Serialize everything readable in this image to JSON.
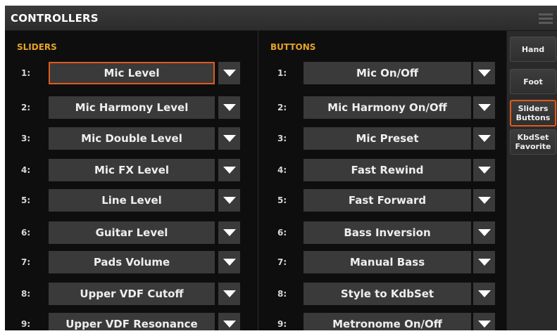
{
  "header": {
    "title": "CONTROLLERS",
    "menu_icon": "hamburger-menu-icon"
  },
  "sliders": {
    "label": "SLIDERS",
    "rows": [
      {
        "num": "1:",
        "value": "Mic Level"
      },
      {
        "num": "2:",
        "value": "Mic Harmony Level"
      },
      {
        "num": "3:",
        "value": "Mic Double Level"
      },
      {
        "num": "4:",
        "value": "Mic FX Level"
      },
      {
        "num": "5:",
        "value": "Line Level"
      },
      {
        "num": "6:",
        "value": "Guitar Level"
      },
      {
        "num": "7:",
        "value": "Pads Volume"
      },
      {
        "num": "8:",
        "value": "Upper VDF Cutoff"
      },
      {
        "num": "9:",
        "value": "Upper VDF Resonance"
      }
    ]
  },
  "buttons": {
    "label": "BUTTONS",
    "rows": [
      {
        "num": "1:",
        "value": "Mic On/Off"
      },
      {
        "num": "2:",
        "value": "Mic Harmony On/Off"
      },
      {
        "num": "3:",
        "value": "Mic Preset"
      },
      {
        "num": "4:",
        "value": "Fast Rewind"
      },
      {
        "num": "5:",
        "value": "Fast Forward"
      },
      {
        "num": "6:",
        "value": "Bass Inversion"
      },
      {
        "num": "7:",
        "value": "Manual Bass"
      },
      {
        "num": "8:",
        "value": "Style to KdbSet"
      },
      {
        "num": "9:",
        "value": "Metronome On/Off"
      }
    ]
  },
  "tabs": [
    {
      "line1": "Hand",
      "line2": ""
    },
    {
      "line1": "Foot",
      "line2": ""
    },
    {
      "line1": "Sliders",
      "line2": "Buttons"
    },
    {
      "line1": "KbdSet",
      "line2": "Favorite"
    }
  ],
  "colors": {
    "accent": "#e05a1e",
    "section_label": "#e6a227",
    "background": "#0e0e0e"
  }
}
